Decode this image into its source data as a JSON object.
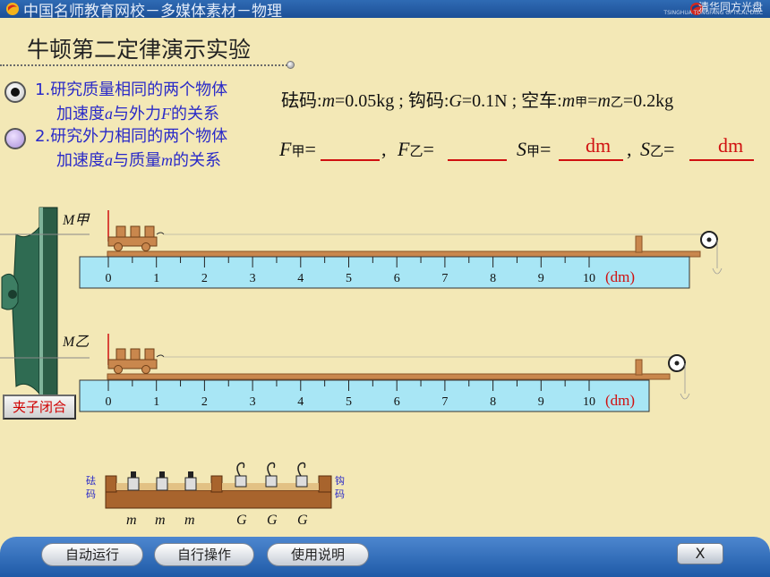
{
  "header": {
    "title": "中国名师教育网校－多媒体素材－物理",
    "brand": "清华同方光盘",
    "brand_sub": "TSINGHUA TONGFANG OPTICAL DISC"
  },
  "page_title": "牛顿第二定律演示实验",
  "options": [
    {
      "number": "1.",
      "line1": "研究质量相同的两个物体",
      "line2": "加速度a与外力F的关系",
      "selected": true
    },
    {
      "number": "2.",
      "line1": "研究外力相同的两个物体",
      "line2": "加速度a与质量m的关系",
      "selected": false
    }
  ],
  "params": "砝码:m=0.05kg ; 钩码:G=0.1N ; 空车:m甲=m乙=0.2kg",
  "formula": {
    "f_jia": "F甲=",
    "f_yi": "F乙=",
    "s_jia": "S甲=",
    "s_yi": "S乙=",
    "comma": ",",
    "s_jia_unit": "dm",
    "s_yi_unit": "dm"
  },
  "tracks": [
    {
      "label": "M甲",
      "ticks": [
        "0",
        "1",
        "2",
        "3",
        "4",
        "5",
        "6",
        "7",
        "8",
        "9",
        "10"
      ],
      "unit": "(dm)"
    },
    {
      "label": "M乙",
      "ticks": [
        "0",
        "1",
        "2",
        "3",
        "4",
        "5",
        "6",
        "7",
        "8",
        "9",
        "10"
      ],
      "unit": "(dm)"
    }
  ],
  "clip_button": "夹子闭合",
  "tray": {
    "left_label": [
      "砝",
      "码"
    ],
    "right_label": [
      "钩",
      "码"
    ],
    "weights": [
      "m",
      "m",
      "m"
    ],
    "hooks": [
      "G",
      "G",
      "G"
    ]
  },
  "toolbar": {
    "auto_run": "自动运行",
    "manual": "自行操作",
    "help": "使用说明",
    "close": "X"
  },
  "colors": {
    "background": "#f3e8b6",
    "ruler": "#a8e6f5",
    "rail": "#c9874d",
    "red": "#d01010",
    "blue_text": "#2a2ac8"
  }
}
